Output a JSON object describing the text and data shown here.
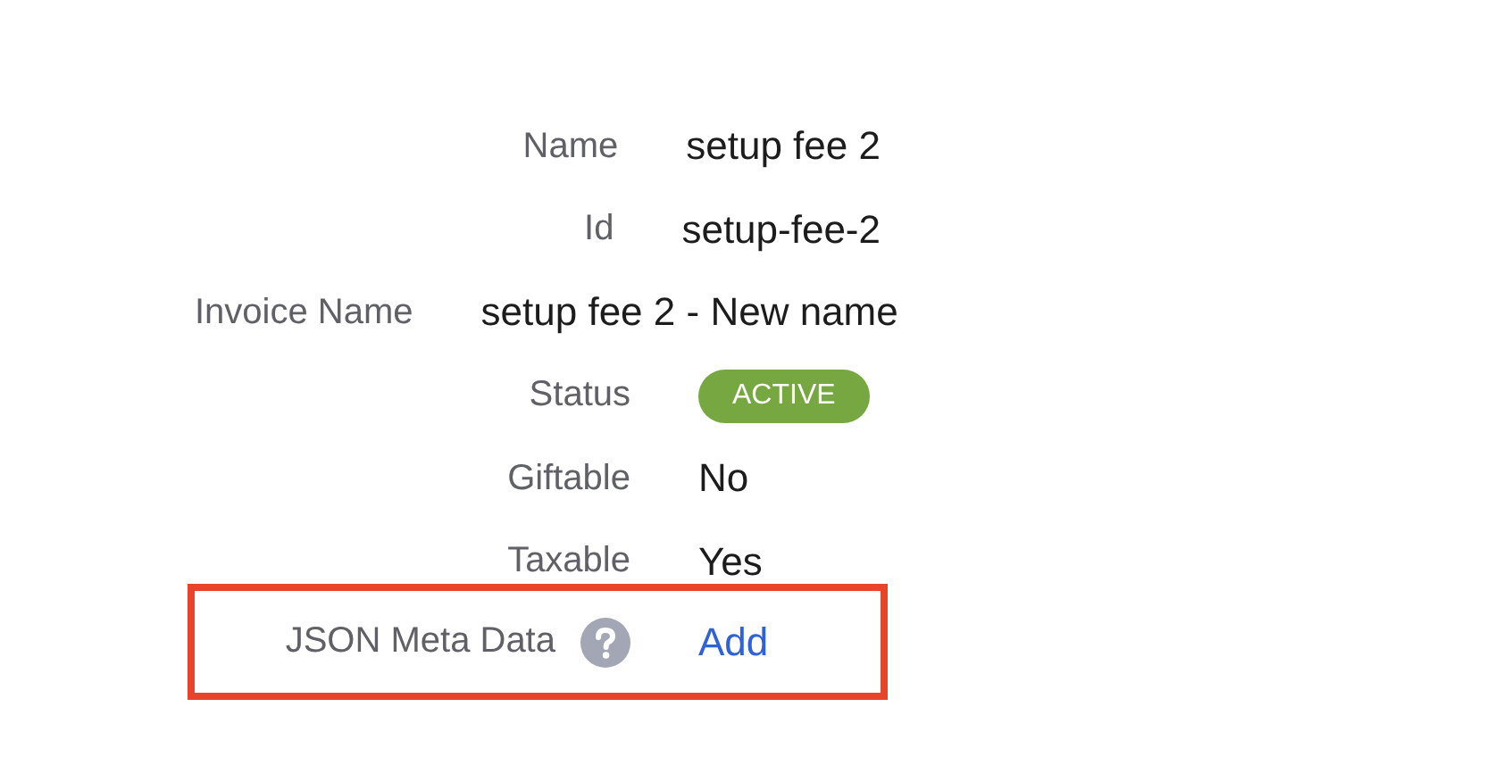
{
  "fields": [
    {
      "label": "Name",
      "kind": "text",
      "value": "setup fee 2",
      "help": false,
      "highlighted": false
    },
    {
      "label": "Id",
      "kind": "text",
      "value": "setup-fee-2",
      "help": false,
      "highlighted": false
    },
    {
      "label": "Invoice Name",
      "kind": "text",
      "value": "setup fee 2 - New name",
      "help": false,
      "highlighted": false
    },
    {
      "label": "Status",
      "kind": "badge",
      "value": "ACTIVE",
      "color": "#76a740",
      "help": false,
      "highlighted": false
    },
    {
      "label": "Giftable",
      "kind": "text",
      "value": "No",
      "help": false,
      "highlighted": false
    },
    {
      "label": "Taxable",
      "kind": "text",
      "value": "Yes",
      "help": false,
      "highlighted": false
    },
    {
      "label": "JSON Meta Data",
      "kind": "link",
      "value": "Add",
      "help": true,
      "highlighted": true
    }
  ]
}
